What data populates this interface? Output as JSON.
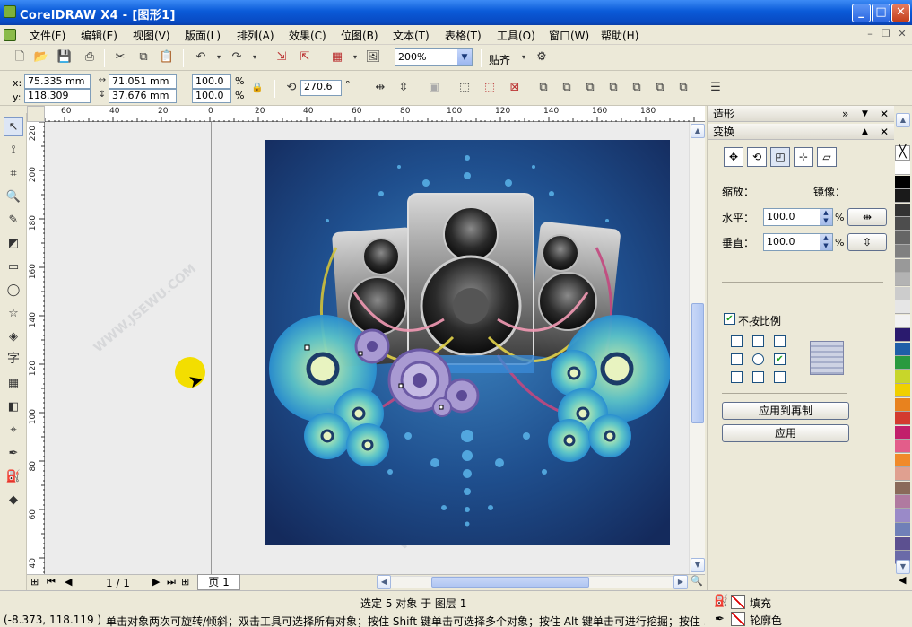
{
  "window": {
    "title": "CorelDRAW X4 - [图形1]"
  },
  "menu": [
    "文件(F)",
    "编辑(E)",
    "视图(V)",
    "版面(L)",
    "排列(A)",
    "效果(C)",
    "位图(B)",
    "文本(T)",
    "表格(T)",
    "工具(O)",
    "窗口(W)",
    "帮助(H)"
  ],
  "toolbar": {
    "zoom": "200%",
    "snap": "贴齐"
  },
  "property_bar": {
    "x_label": "x:",
    "x": "75.335 mm",
    "y_label": "y:",
    "y": "118.309 mm",
    "w": "71.051 mm",
    "h": "37.676 mm",
    "scale_w": "100.0",
    "scale_h": "100.0",
    "pct": "%",
    "rotation": "270.6",
    "deg": "°"
  },
  "rulers": {
    "h_ticks": [
      "60",
      "40",
      "20",
      "0",
      "20",
      "40",
      "60",
      "80",
      "100",
      "120",
      "140",
      "160",
      "180"
    ],
    "v_ticks": [
      "220",
      "200",
      "180",
      "160",
      "140",
      "120",
      "100",
      "80",
      "60",
      "40"
    ]
  },
  "pagebar": {
    "page_count": "1 / 1",
    "tab": "页 1"
  },
  "docker": {
    "outer_title": "造形",
    "inner_title": "变换",
    "scale_label": "缩放：",
    "mirror_label": "镜像：",
    "h_label": "水平：",
    "h_value": "100.0",
    "v_label": "垂直：",
    "v_value": "100.0",
    "pct": "%",
    "nonprop_label": "不按比例",
    "apply_dup": "应用到再制",
    "apply": "应用"
  },
  "palette_colors": [
    "#ffffff",
    "#000000",
    "#1a1a1a",
    "#333333",
    "#4d4d4d",
    "#666666",
    "#808080",
    "#999999",
    "#b3b3b3",
    "#cccccc",
    "#e6e6e6",
    "#f2f2f2",
    "#2a1a6e",
    "#1f5fa8",
    "#2a9a3f",
    "#c8d62a",
    "#f0d000",
    "#e8821e",
    "#d33a2f",
    "#c21f6b",
    "#e35d8a",
    "#f08a2a",
    "#e0a090",
    "#8a6a5a",
    "#b07aa0",
    "#9a8ac8",
    "#7080b8",
    "#5c5090",
    "#6a6aa8"
  ],
  "status": {
    "coords": "(-8.373, 118.119 )",
    "selection": "选定 5 对象 于 图层 1",
    "hint": "单击对象两次可旋转/倾斜；双击工具可选择所有对象；按住 Shift 键单击可选择多个对象；按住 Alt 键单击可进行挖掘；按住 ...",
    "fill_label": "填充",
    "outline_label": "轮廓色"
  }
}
